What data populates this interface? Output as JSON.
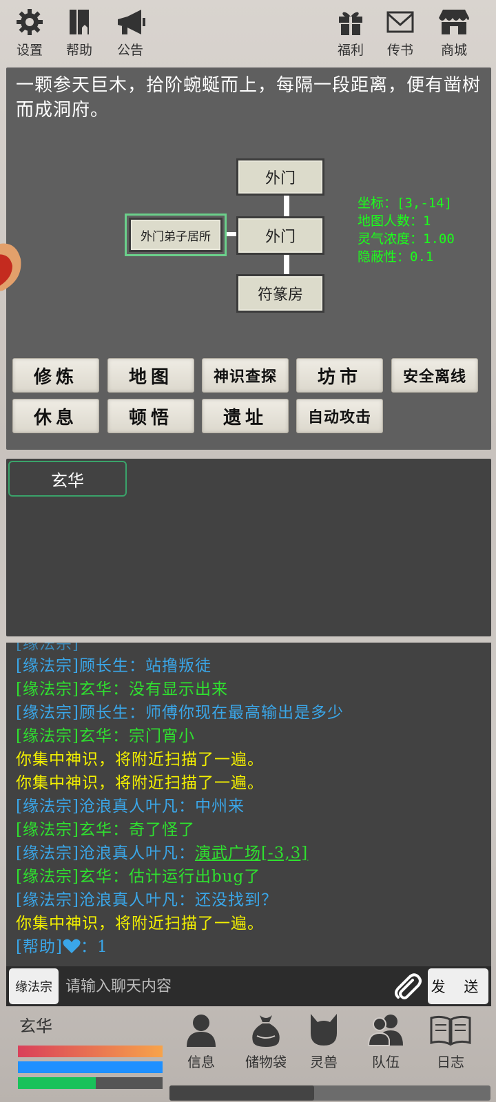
{
  "topbar": {
    "left": [
      {
        "label": "设置",
        "icon": "gear-icon"
      },
      {
        "label": "帮助",
        "icon": "book-icon"
      },
      {
        "label": "公告",
        "icon": "megaphone-icon"
      }
    ],
    "right": [
      {
        "label": "福利",
        "icon": "gift-icon"
      },
      {
        "label": "传书",
        "icon": "mail-icon"
      },
      {
        "label": "商城",
        "icon": "shop-icon"
      }
    ]
  },
  "scene": {
    "description": "一颗参天巨木，拾阶蜿蜒而上，每隔一段距离，便有凿树而成洞府。",
    "nodes": {
      "top": "外门",
      "center": "外门",
      "bottom": "符篆房",
      "left": "外门弟子居所"
    },
    "info": {
      "coords": "坐标：[3,-14]",
      "players": "地图人数：1",
      "spirit": "灵气浓度：1.00",
      "stealth": "隐蔽性：0.1"
    }
  },
  "actions": {
    "row1": [
      "修炼",
      "地图",
      "神识查探",
      "坊市",
      "安全离线"
    ],
    "row2": [
      "休息",
      "顿悟",
      "遗址",
      "自动攻击"
    ]
  },
  "chat_tabs": {
    "active": "玄华"
  },
  "chat": {
    "messages": [
      {
        "text": "[缘法宗]顾长生：站撸叛徒",
        "color": "blue"
      },
      {
        "text": "[缘法宗]玄华：没有显示出来",
        "color": "green"
      },
      {
        "text": "[缘法宗]顾长生：师傅你现在最高输出是多少",
        "color": "blue"
      },
      {
        "text": "[缘法宗]玄华：宗门宵小",
        "color": "green"
      },
      {
        "text": "你集中神识，将附近扫描了一遍。",
        "color": "yellow"
      },
      {
        "text": "你集中神识，将附近扫描了一遍。",
        "color": "yellow"
      },
      {
        "text": "[缘法宗]沧浪真人叶凡：中州来",
        "color": "blue"
      },
      {
        "text": "[缘法宗]玄华：奇了怪了",
        "color": "green"
      },
      {
        "prefix": "[缘法宗]沧浪真人叶凡：",
        "link": "演武广场[-3,3]",
        "color": "blue"
      },
      {
        "text": "[缘法宗]玄华：估计运行出bug了",
        "color": "green"
      },
      {
        "text": "[缘法宗]沧浪真人叶凡：还没找到？",
        "color": "blue"
      },
      {
        "text": "你集中神识，将附近扫描了一遍。",
        "color": "yellow"
      },
      {
        "prefix": "[帮助]",
        "heart_icon": "heart-icon",
        "suffix": "：1",
        "color": "blue"
      }
    ],
    "channel": "缘法宗",
    "placeholder": "请输入聊天内容",
    "send_label": "发 送"
  },
  "player": {
    "name": "玄华",
    "hp_fraction": 1.0,
    "mp_fraction": 1.0,
    "exp_fraction": 0.54
  },
  "nav": [
    {
      "label": "信息",
      "icon": "person-icon"
    },
    {
      "label": "储物袋",
      "icon": "bag-icon"
    },
    {
      "label": "灵兽",
      "icon": "beast-icon"
    },
    {
      "label": "队伍",
      "icon": "team-icon"
    },
    {
      "label": "日志",
      "icon": "open-book-icon"
    }
  ],
  "colors": {
    "info_green": "#1bff1b",
    "chat_blue": "#3aa6e8",
    "chat_green": "#2fe02f",
    "chat_yellow": "#f3f000",
    "hp_gradient": [
      "#d9405a",
      "#f7a34a"
    ],
    "mp": "#1e90ff",
    "exp": "#19c25a"
  }
}
